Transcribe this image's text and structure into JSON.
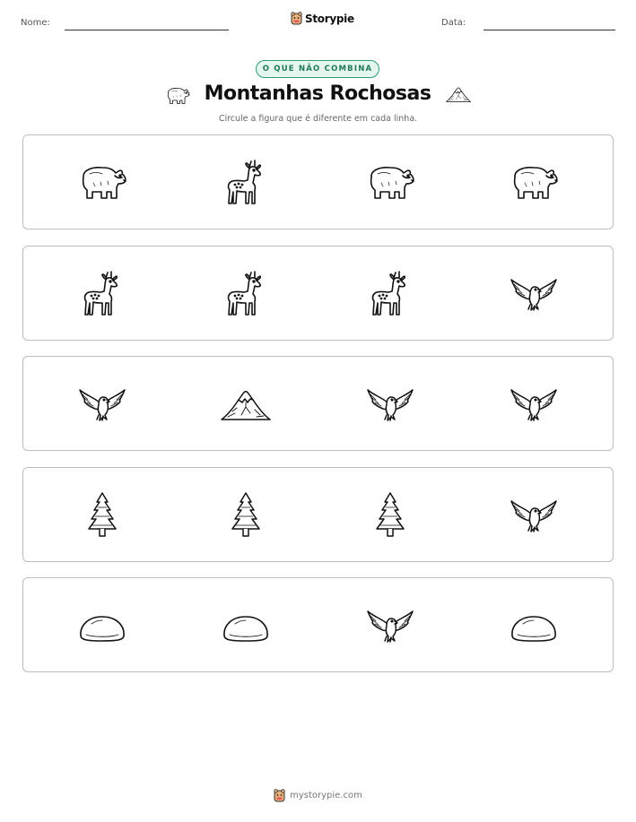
{
  "header": {
    "name_label": "Nome:",
    "date_label": "Data:",
    "brand": "Storypie"
  },
  "badge": "O QUE NÃO COMBINA",
  "title": "Montanhas Rochosas",
  "subtitle": "Circule a figura que é diferente em cada linha.",
  "rows": [
    [
      "bear",
      "deer",
      "bear",
      "bear"
    ],
    [
      "deer",
      "deer",
      "deer",
      "eagle"
    ],
    [
      "eagle",
      "mountain",
      "eagle",
      "eagle"
    ],
    [
      "pine-tree",
      "pine-tree",
      "pine-tree",
      "eagle"
    ],
    [
      "rock",
      "rock",
      "eagle",
      "rock"
    ]
  ],
  "footer": "mystorypie.com"
}
